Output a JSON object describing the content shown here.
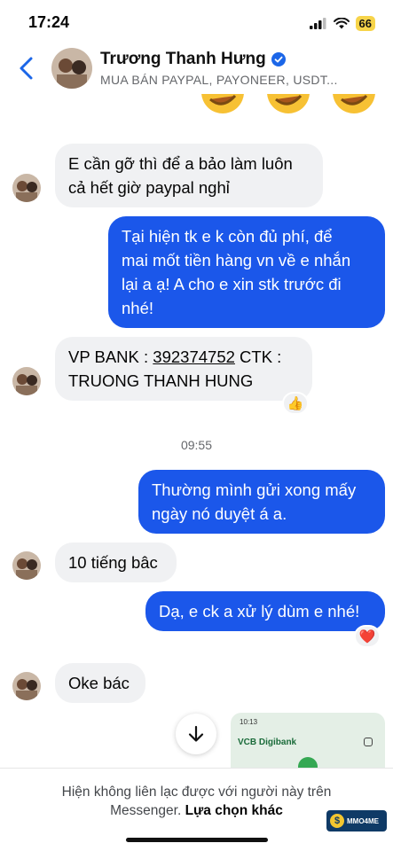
{
  "status_bar": {
    "time": "17:24",
    "battery": "66"
  },
  "header": {
    "name": "Trương Thanh Hưng",
    "subtitle": "MUA BÁN PAYPAL, PAYONEER, USDT...",
    "verified_icon": "verified-badge-icon"
  },
  "messages": [
    {
      "direction": "incoming",
      "lines": [
        "E cần gỡ thì để a bảo làm luôn",
        "cả hết giờ paypal nghỉ"
      ]
    },
    {
      "direction": "outgoing",
      "lines": [
        "Tại hiện tk e k còn đủ phí, để",
        "mai mốt tiền hàng vn về e nhắn",
        "lại a ạ! A cho e xin stk trước đi",
        "nhé!"
      ]
    },
    {
      "direction": "incoming",
      "prefix": "VP BANK : ",
      "account": "392374752",
      "suffix": " CTK :",
      "line2": "TRUONG THANH HUNG",
      "reaction": "👍"
    },
    {
      "direction": "outgoing",
      "lines": [
        "Thường mình gửi xong mấy",
        "ngày nó duyệt á a."
      ]
    },
    {
      "direction": "incoming",
      "lines": [
        "10 tiếng bâc"
      ]
    },
    {
      "direction": "outgoing",
      "lines": [
        "Dạ, e ck a xử lý dùm e nhé!"
      ],
      "reaction": "❤️"
    },
    {
      "direction": "incoming",
      "lines": [
        "Oke bác"
      ]
    }
  ],
  "timestamp": "09:55",
  "attachment": {
    "time": "10:13",
    "brand": "VCB Digibank"
  },
  "footer": {
    "text": "Hiện không liên lạc được với người này trên",
    "text2": "Messenger.",
    "link": "Lựa chọn khác"
  },
  "watermark": {
    "text": "MMO4ME"
  },
  "colors": {
    "outgoing": "#1b57ea",
    "incoming": "#f0f1f3",
    "accent": "#1b57ea"
  }
}
